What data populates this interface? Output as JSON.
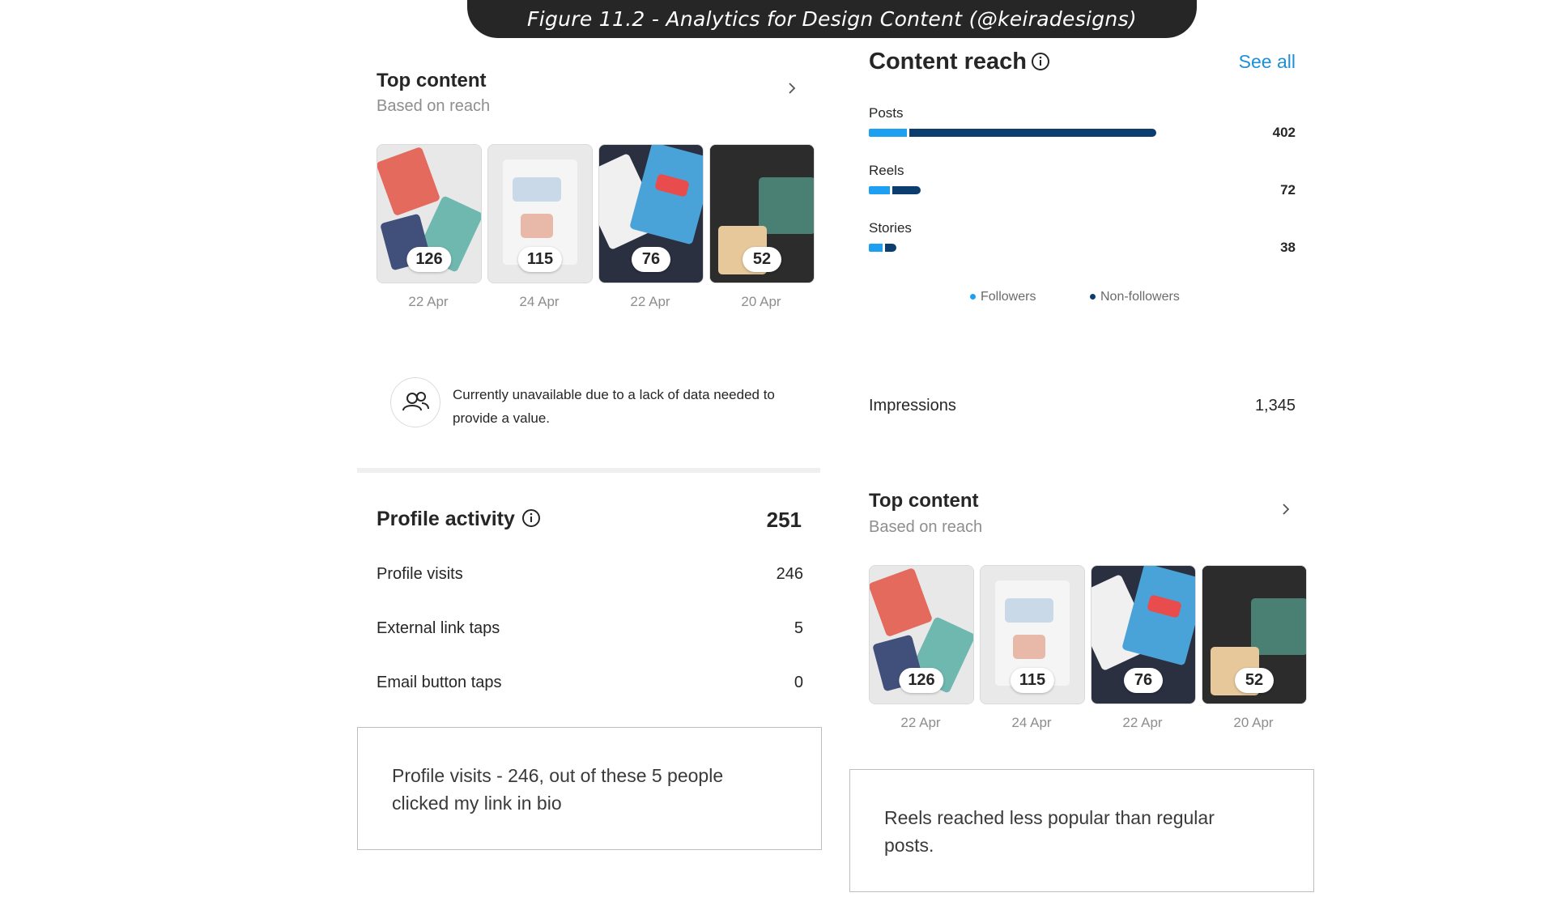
{
  "caption": "Figure 11.2 - Analytics for Design Content (@keiradesigns)",
  "colors": {
    "followers": "#1ea0f2",
    "non_followers": "#0b3d6e",
    "link_blue": "#1877f2",
    "caption_bg": "#262626"
  },
  "top_content_left": {
    "title": "Top content",
    "subtitle": "Based on reach",
    "items": [
      {
        "count": "126",
        "date": "22 Apr"
      },
      {
        "count": "115",
        "date": "24 Apr"
      },
      {
        "count": "76",
        "date": "22 Apr"
      },
      {
        "count": "52",
        "date": "20 Apr"
      }
    ]
  },
  "unavailable": {
    "icon": "people-icon",
    "line1": "Currently unavailable due to a lack of data needed to",
    "line2": "provide a value."
  },
  "profile_activity": {
    "title": "Profile activity",
    "total": "251",
    "rows": [
      {
        "label": "Profile visits",
        "value": "246"
      },
      {
        "label": "External link taps",
        "value": "5"
      },
      {
        "label": "Email button taps",
        "value": "0"
      }
    ]
  },
  "note_left": {
    "line1": "Profile visits - 246, out of these 5 people",
    "line2": "clicked my link in bio"
  },
  "content_reach": {
    "title": "Content reach",
    "see_all": "See all",
    "bars": [
      {
        "label": "Posts",
        "value": "402",
        "total": 402,
        "followers": 53
      },
      {
        "label": "Reels",
        "value": "72",
        "total": 72,
        "followers": 29
      },
      {
        "label": "Stories",
        "value": "38",
        "total": 38,
        "followers": 19
      }
    ],
    "max": 402,
    "legend": [
      "Followers",
      "Non-followers"
    ]
  },
  "impressions": {
    "label": "Impressions",
    "value": "1,345"
  },
  "top_content_right": {
    "title": "Top content",
    "subtitle": "Based on reach",
    "items": [
      {
        "count": "126",
        "date": "22 Apr"
      },
      {
        "count": "115",
        "date": "24 Apr"
      },
      {
        "count": "76",
        "date": "22 Apr"
      },
      {
        "count": "52",
        "date": "20 Apr"
      }
    ]
  },
  "note_right": {
    "line1": "Reels reached less popular than regular",
    "line2": "posts."
  }
}
